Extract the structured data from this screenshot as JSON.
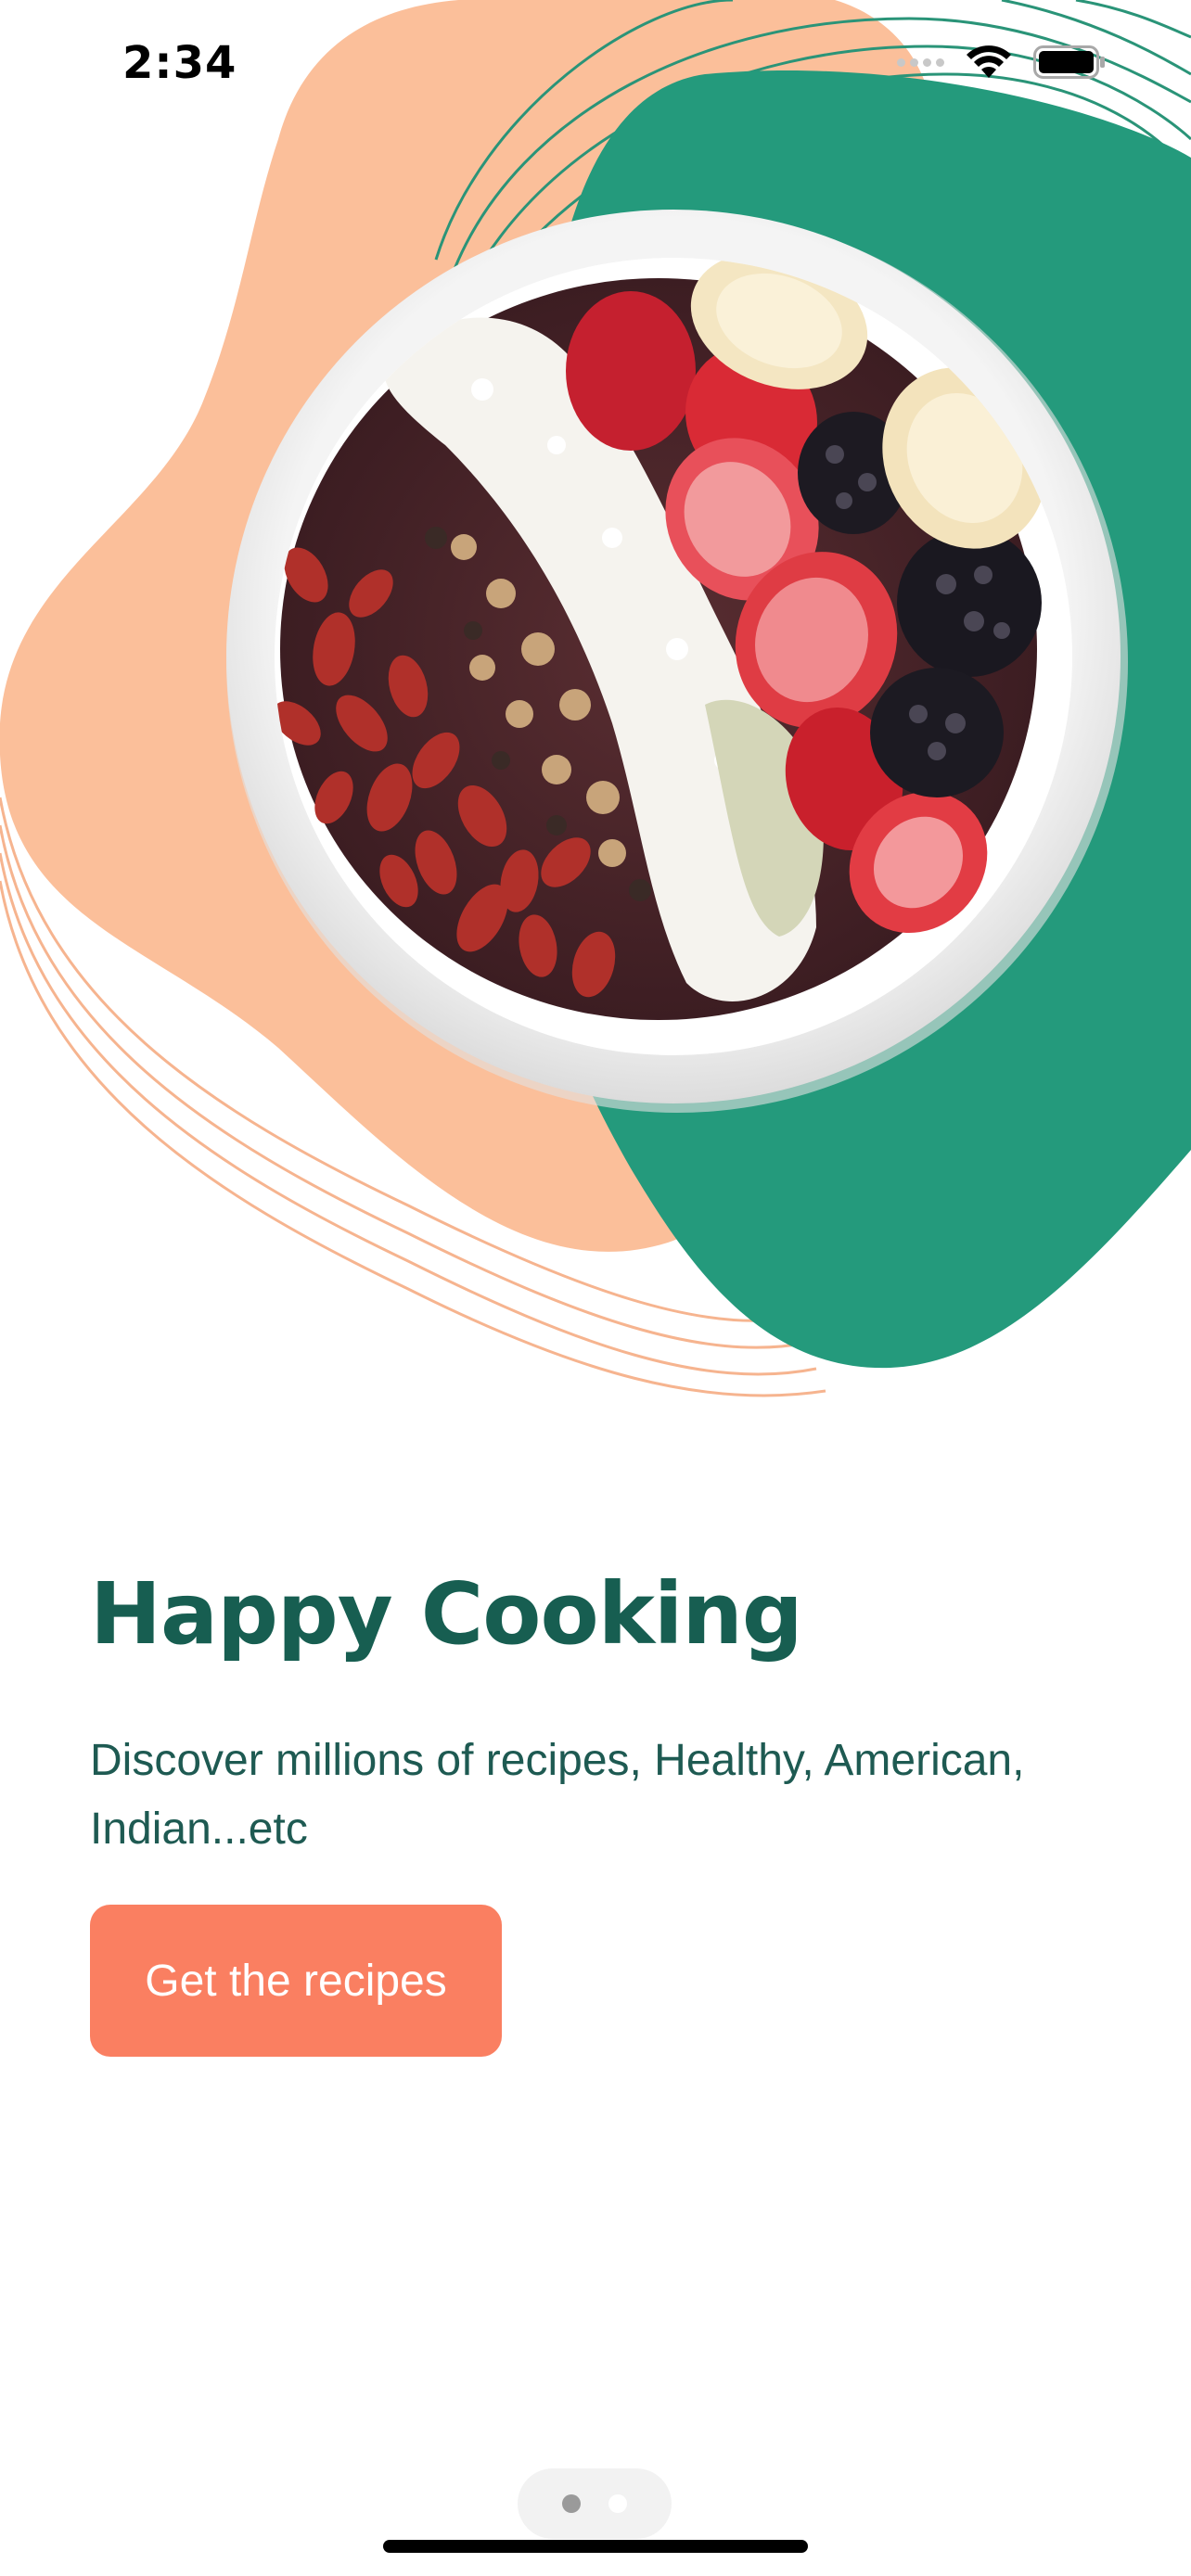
{
  "status_bar": {
    "time": "2:34",
    "icons": [
      "signal-icon",
      "wifi-icon",
      "battery-icon"
    ]
  },
  "hero": {
    "image_subject": "acai bowl with strawberries, banana, blackberries, coconut flakes, nuts and goji berries",
    "colors": {
      "peach_blob": "#fbbf9a",
      "teal_blob": "#249a7c",
      "teal_lines": "#2a9478",
      "peach_lines": "#f6b48f"
    }
  },
  "onboarding": {
    "title": "Happy Cooking",
    "subtitle": "Discover millions of recipes, Healthy, American, Indian...etc",
    "cta_label": "Get the recipes"
  },
  "pagination": {
    "total_pages": 2,
    "current_page": 1
  },
  "colors": {
    "title": "#175e51",
    "subtitle": "#1e5a52",
    "button": "#fa7f61",
    "button_text": "#ffffff"
  }
}
